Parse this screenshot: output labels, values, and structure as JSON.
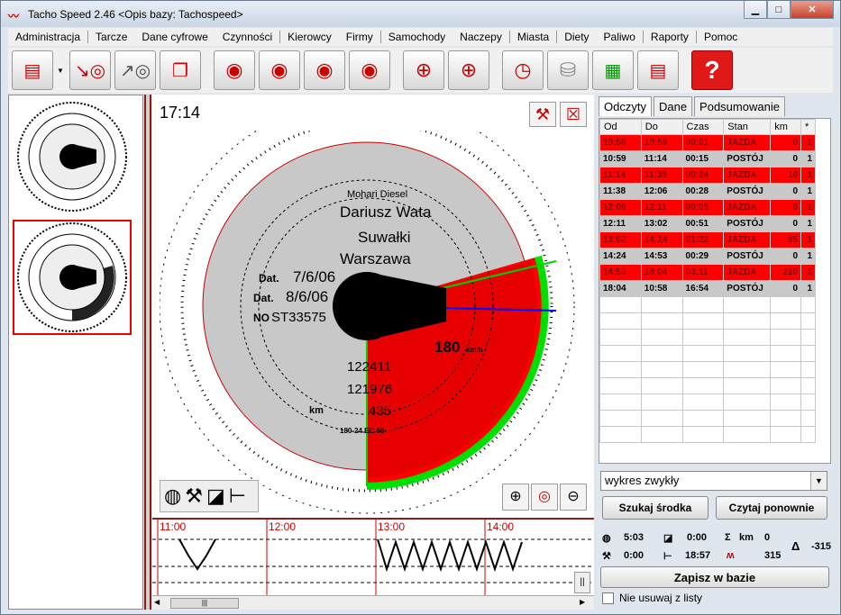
{
  "app": {
    "title": "Tacho Speed 2.46   <Opis bazy: Tachospeed>"
  },
  "menu": [
    "Administracja",
    "Tarcze",
    "Dane cyfrowe",
    "Czynności",
    "Kierowcy",
    "Firmy",
    "Samochody",
    "Naczepy",
    "Miasta",
    "Diety",
    "Paliwo",
    "Raporty",
    "Pomoc"
  ],
  "toolbar_icons": [
    "scanner-icon",
    "import-disc-icon",
    "export-disc-icon",
    "copy-discs-icon",
    "rotate-down-icon",
    "rotate-up-icon",
    "rotate-left-icon",
    "rotate-right-icon",
    "center-disc-icon",
    "center-disc-alt-icon",
    "clock-calculator-icon",
    "database-disc-icon",
    "stats-board-icon",
    "annex-document-icon",
    "help-icon"
  ],
  "center": {
    "time": "17:14"
  },
  "disc": {
    "company": "Mohari Diesel",
    "driver": "Dariusz Wata",
    "from": "Suwałki",
    "to": "Warszawa",
    "dat1": "7/6/06",
    "dat2": "8/6/06",
    "no": "ST33575",
    "km_start": "122411",
    "km_end": "121976",
    "km": "435",
    "speed": "180",
    "speed_unit": "km/h",
    "code": "180-24 EC 68"
  },
  "chart_hours": [
    "11:00",
    "12:00",
    "13:00",
    "14:00"
  ],
  "tabs": [
    "Odczyty",
    "Dane",
    "Podsumowanie"
  ],
  "columns": [
    "Od",
    "Do",
    "Czas",
    "Stan",
    "km",
    "*"
  ],
  "rows": [
    [
      "10:58",
      "10:59",
      "00:01",
      "JAZDA",
      "0",
      "1"
    ],
    [
      "10:59",
      "11:14",
      "00:15",
      "POSTÓJ",
      "0",
      "1"
    ],
    [
      "11:14",
      "11:38",
      "00:24",
      "JAZDA",
      "10",
      "1"
    ],
    [
      "11:38",
      "12:06",
      "00:28",
      "POSTÓJ",
      "0",
      "1"
    ],
    [
      "12:06",
      "12:11",
      "00:05",
      "JAZDA",
      "0",
      "1"
    ],
    [
      "12:11",
      "13:02",
      "00:51",
      "POSTÓJ",
      "0",
      "1"
    ],
    [
      "13:02",
      "14:24",
      "01:22",
      "JAZDA",
      "95",
      "1"
    ],
    [
      "14:24",
      "14:53",
      "00:29",
      "POSTÓJ",
      "0",
      "1"
    ],
    [
      "14:53",
      "18:04",
      "03:11",
      "JAZDA",
      "210",
      "1"
    ],
    [
      "18:04",
      "10:58",
      "16:54",
      "POSTÓJ",
      "0",
      "1"
    ]
  ],
  "select_value": "wykres zwykły",
  "buttons": {
    "search": "Szukaj środka",
    "reread": "Czytaj ponownie",
    "save": "Zapisz w bazie"
  },
  "stats": {
    "drive": "5:03",
    "avail": "0:00",
    "sum_km_label": "km",
    "sum_km": "0",
    "work": "0:00",
    "rest": "18:57",
    "speed": "315",
    "delta": "-315"
  },
  "checkbox": "Nie usuwaj z listy"
}
